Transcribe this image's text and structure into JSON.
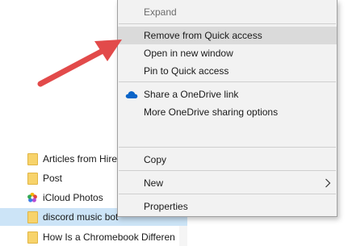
{
  "navigation": {
    "items": [
      {
        "label": "Articles from Hire",
        "icon": "folder-icon"
      },
      {
        "label": "Post",
        "icon": "folder-icon"
      },
      {
        "label": "iCloud Photos",
        "icon": "icloud-photos-icon"
      },
      {
        "label": "discord music bot",
        "icon": "folder-icon",
        "selected": true
      },
      {
        "label": "How Is a Chromebook Differen",
        "icon": "folder-icon"
      }
    ]
  },
  "context_menu": {
    "items": [
      {
        "label": "Expand",
        "disabled": true
      },
      {
        "label": "Remove from Quick access",
        "highlighted": true
      },
      {
        "label": "Open in new window"
      },
      {
        "label": "Pin to Quick access"
      },
      {
        "label": "Share a OneDrive link",
        "icon": "onedrive-cloud-icon"
      },
      {
        "label": "More OneDrive sharing options"
      },
      {
        "label": "Copy"
      },
      {
        "label": "New",
        "has_submenu": true
      },
      {
        "label": "Properties"
      }
    ]
  },
  "colors": {
    "menu_background": "#f2f2f2",
    "menu_highlight": "#dadada",
    "selection": "#cce4f7",
    "annotation_arrow": "#e24a4a",
    "onedrive_blue": "#0a64c8"
  }
}
